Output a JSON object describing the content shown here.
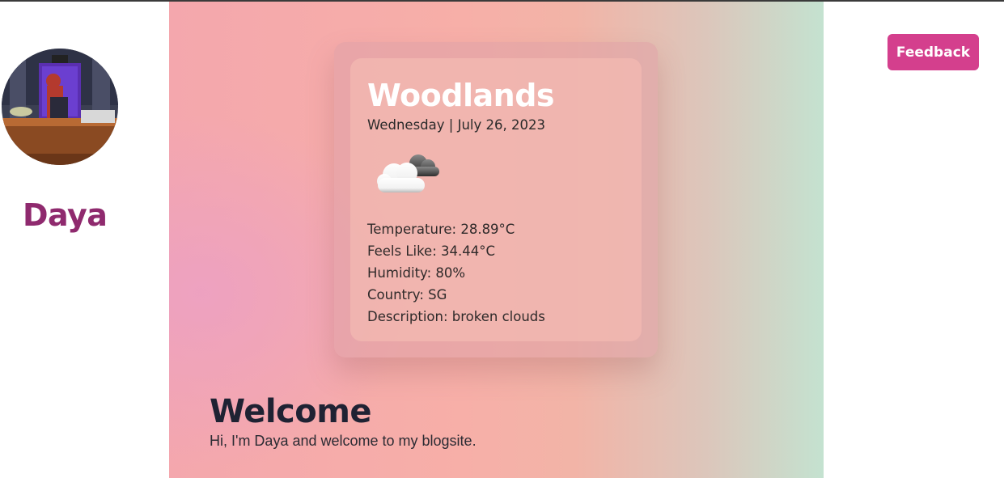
{
  "profile": {
    "name": "Daya",
    "avatar_icon": "profile-avatar-image"
  },
  "feedback": {
    "label": "Feedback",
    "color": "#d43f8d"
  },
  "weather": {
    "city": "Woodlands",
    "date": "Wednesday | July 26, 2023",
    "icon": "broken-clouds-icon",
    "details": [
      "Temperature: 28.89°C",
      "Feels Like: 34.44°C",
      "Humidity: 80%",
      "Country: SG",
      "Description: broken clouds"
    ]
  },
  "welcome": {
    "title": "Welcome",
    "text": "Hi, I'm Daya and welcome to my blogsite."
  },
  "colors": {
    "name_color": "#8f2a6e",
    "heading_color": "#1f2233"
  }
}
